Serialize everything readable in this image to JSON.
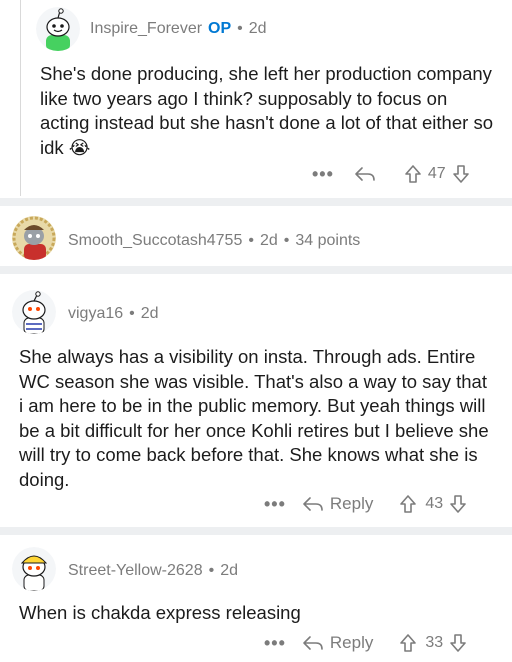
{
  "comments": [
    {
      "username": "Inspire_Forever",
      "op_badge": "OP",
      "age": "2d",
      "body": "She's done producing, she left her production company like two years ago I think? supposably to focus on acting instead but she hasn't done a lot of that either so idk 😭",
      "votes": "47"
    },
    {
      "username": "Smooth_Succotash4755",
      "age": "2d",
      "points": "34 points"
    },
    {
      "username": "vigya16",
      "age": "2d",
      "body": "She always has a visibility on insta. Through ads. Entire WC season she was visible. That's also a way to say that i am here to be in the public memory. But yeah things will be a bit difficult for her once Kohli retires but I believe she will try to come back before that. She knows what she is doing.",
      "reply_label": "Reply",
      "votes": "43"
    },
    {
      "username": "Street-Yellow-2628",
      "age": "2d",
      "body": "When is chakda express releasing",
      "reply_label": "Reply",
      "votes": "33"
    }
  ],
  "glyphs": {
    "dot": "•",
    "more": "•••"
  },
  "icons": [
    "reply-icon",
    "upvote-icon",
    "downvote-icon",
    "more-options-icon",
    "avatar"
  ],
  "colors": {
    "op": "#0079d3",
    "meta": "#7c7c7c",
    "separator": "#edeff1"
  }
}
